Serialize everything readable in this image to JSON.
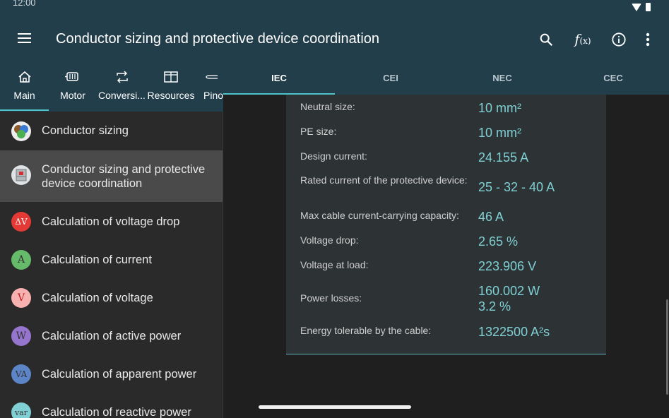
{
  "status": {
    "time": "12:00"
  },
  "appbar": {
    "title": "Conductor sizing and protective device coordination",
    "fx_label": "f",
    "fx_sub": "(x)"
  },
  "nav_tabs": [
    {
      "label": "Main",
      "icon": "home-icon"
    },
    {
      "label": "Motor",
      "icon": "motor-icon"
    },
    {
      "label": "Conversi...",
      "icon": "conversion-icon"
    },
    {
      "label": "Resources",
      "icon": "resources-icon"
    },
    {
      "label": "Pino",
      "icon": "pinout-icon"
    }
  ],
  "standard_tabs": [
    "IEC",
    "CEI",
    "NEC",
    "CEC"
  ],
  "sidebar": {
    "items": [
      {
        "label": "Conductor sizing",
        "icon": ""
      },
      {
        "label": "Conductor sizing and protective device coordination",
        "icon": ""
      },
      {
        "label": "Calculation of voltage drop",
        "icon": "ΔV"
      },
      {
        "label": "Calculation of current",
        "icon": "A"
      },
      {
        "label": "Calculation of voltage",
        "icon": "V"
      },
      {
        "label": "Calculation of active power",
        "icon": "W"
      },
      {
        "label": "Calculation of apparent power",
        "icon": "VA"
      },
      {
        "label": "Calculation of reactive power",
        "icon": "var"
      }
    ]
  },
  "results": [
    {
      "label": "Neutral size:",
      "value": "10 mm²"
    },
    {
      "label": "PE size:",
      "value": "10 mm²"
    },
    {
      "label": "Design current:",
      "value": "24.155 A"
    },
    {
      "label": "Rated current of the protective device:",
      "value": "25 - 32 - 40 A"
    },
    {
      "label": "Max cable current-carrying capacity:",
      "value": "46 A"
    },
    {
      "label": "Voltage drop:",
      "value": "2.65 %"
    },
    {
      "label": "Voltage at load:",
      "value": "223.906 V"
    },
    {
      "label": "Power losses:",
      "value": "160.002 W",
      "value2": "3.2 %"
    },
    {
      "label": "Energy tolerable by the cable:",
      "value": "1322500 A²s"
    }
  ],
  "colors": {
    "appbar": "#233e4b",
    "accent": "#4fc3c9",
    "value_text": "#7fd0d4"
  }
}
